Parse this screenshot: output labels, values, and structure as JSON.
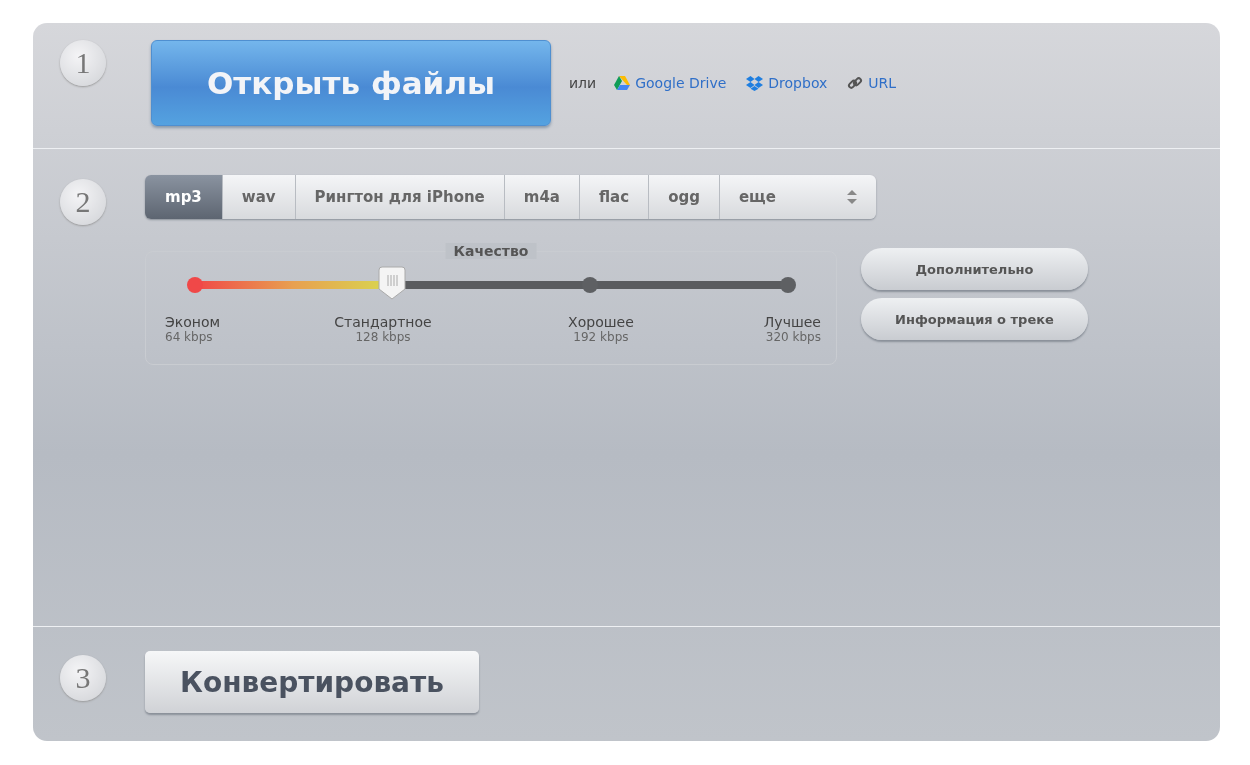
{
  "steps": [
    {
      "number": "1"
    },
    {
      "number": "2"
    },
    {
      "number": "3"
    }
  ],
  "open_button": {
    "label": "Открыть файлы"
  },
  "or_text": "или",
  "sources": [
    {
      "kind": "gdrive",
      "label": "Google Drive"
    },
    {
      "kind": "dropbox",
      "label": "Dropbox"
    },
    {
      "kind": "url",
      "label": "URL"
    }
  ],
  "formats": [
    {
      "label": "mp3",
      "selected": true
    },
    {
      "label": "wav",
      "selected": false
    },
    {
      "label": "Рингтон для iPhone",
      "selected": false
    },
    {
      "label": "m4a",
      "selected": false
    },
    {
      "label": "flac",
      "selected": false
    },
    {
      "label": "ogg",
      "selected": false
    }
  ],
  "more_formats": {
    "label": "еще"
  },
  "quality": {
    "title": "Качество",
    "level": 0.333,
    "stops": [
      {
        "name": "Эконом",
        "bitrate": "64 kbps"
      },
      {
        "name": "Стандартное",
        "bitrate": "128 kbps"
      },
      {
        "name": "Хорошее",
        "bitrate": "192 kbps"
      },
      {
        "name": "Лучшее",
        "bitrate": "320 kbps"
      }
    ]
  },
  "side_buttons": [
    "Дополнительно",
    "Информация о треке"
  ],
  "convert_button": {
    "label": "Конвертировать"
  }
}
